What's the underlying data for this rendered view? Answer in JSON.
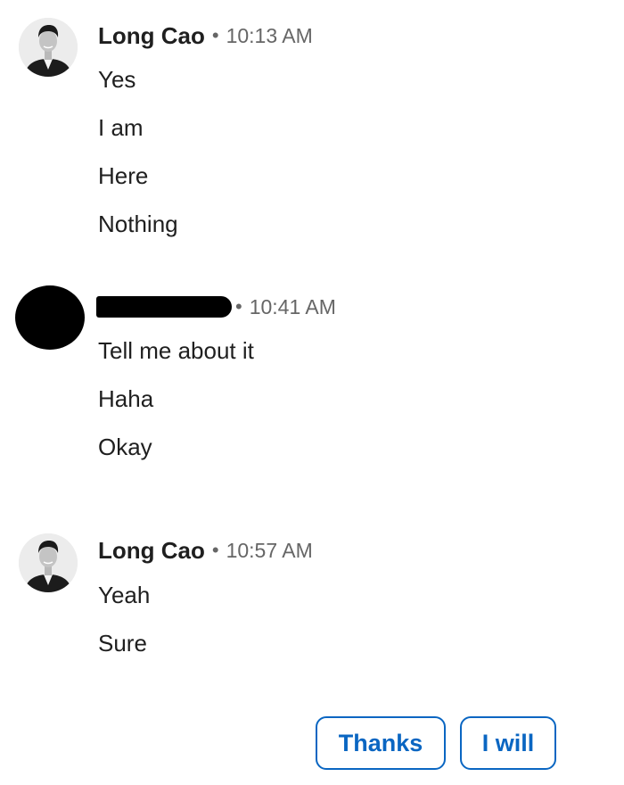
{
  "messages": [
    {
      "sender": "Long Cao",
      "separator": "•",
      "time": "10:13 AM",
      "lines": [
        "Yes",
        "I am",
        "Here",
        "Nothing"
      ],
      "avatar_icon": "person-photo-icon"
    },
    {
      "sender": "",
      "separator": "•",
      "time": "10:41 AM",
      "lines": [
        "Tell me about it",
        "Haha",
        "Okay"
      ],
      "avatar_icon": "redacted-avatar-icon"
    },
    {
      "sender": "Long Cao",
      "separator": "•",
      "time": "10:57 AM",
      "lines": [
        "Yeah",
        "Sure"
      ],
      "avatar_icon": "person-photo-icon"
    }
  ],
  "quick_replies": [
    "Thanks",
    "I will"
  ],
  "colors": {
    "accent": "#0a66c2",
    "text": "#1f1f1f",
    "muted": "#666666"
  }
}
